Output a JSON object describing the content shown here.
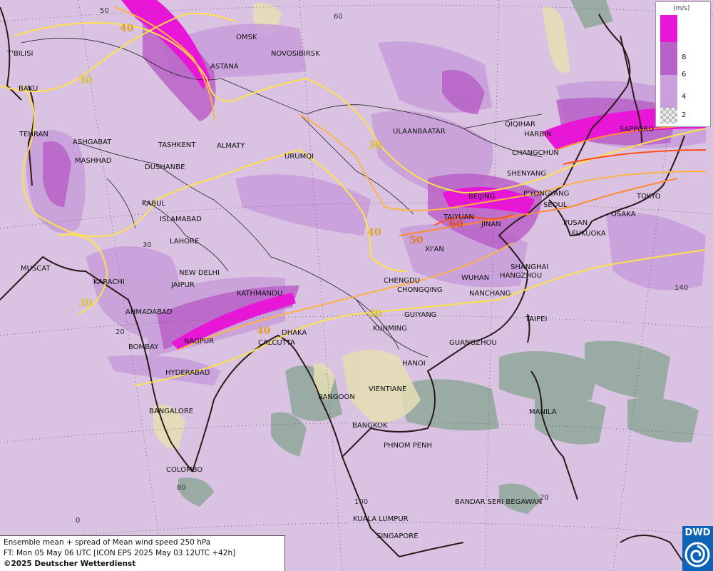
{
  "title_line": "Ensemble mean + spread of Mean wind speed 250 hPa",
  "forecast_line": "FT: Mon 05 May 06 UTC [ICON EPS 2025 May 03 12UTC +42h]",
  "copyright": "©2025 Deutscher Wetterdienst",
  "logo_text": "DWD",
  "legend": {
    "unit": "(m/s)",
    "ticks": [
      "8",
      "6",
      "4",
      "2"
    ],
    "colors": [
      "#e817d8",
      "#b862c7",
      "#c9a0db",
      "#d9c2e2"
    ]
  },
  "colors": {
    "background_spread": "#d9c2e2",
    "jet_core": "#e817d8",
    "contour_30": "#ffe24a",
    "contour_40": "#ffb347",
    "contour_50": "#ff8c33",
    "contour_60": "#ff4d1a",
    "coastline": "#2b1a1a"
  },
  "cities": [
    {
      "name": "T'BILISI"
    },
    {
      "name": "BAKU"
    },
    {
      "name": "TEHRAN"
    },
    {
      "name": "ASHGABAT"
    },
    {
      "name": "MASHHAD"
    },
    {
      "name": "MUSCAT"
    },
    {
      "name": "KARACHI"
    },
    {
      "name": "AHMADABAD"
    },
    {
      "name": "BOMBAY"
    },
    {
      "name": "HYDERABAD"
    },
    {
      "name": "BANGALORE"
    },
    {
      "name": "COLOMBO"
    },
    {
      "name": "OMSK"
    },
    {
      "name": "NOVOSIBIRSK"
    },
    {
      "name": "ASTANA"
    },
    {
      "name": "TASHKENT"
    },
    {
      "name": "ALMATY"
    },
    {
      "name": "DUSHANBE"
    },
    {
      "name": "KABUL"
    },
    {
      "name": "ISLAMABAD"
    },
    {
      "name": "LAHORE"
    },
    {
      "name": "NEW DELHI"
    },
    {
      "name": "JAIPUR"
    },
    {
      "name": "KATHMANDU"
    },
    {
      "name": "NAGPUR"
    },
    {
      "name": "CALCUTTA"
    },
    {
      "name": "DHAKA"
    },
    {
      "name": "URUMQI"
    },
    {
      "name": "ULAANBAATAR"
    },
    {
      "name": "CHENGDU"
    },
    {
      "name": "CHONGQING"
    },
    {
      "name": "KUNMING"
    },
    {
      "name": "GUIYANG"
    },
    {
      "name": "WUHAN"
    },
    {
      "name": "NANCHANG"
    },
    {
      "name": "XI'AN"
    },
    {
      "name": "TAIYUAN"
    },
    {
      "name": "JINAN"
    },
    {
      "name": "BEIJING"
    },
    {
      "name": "SHENYANG"
    },
    {
      "name": "CHANGCHUN"
    },
    {
      "name": "HARBIN"
    },
    {
      "name": "QIQIHAR"
    },
    {
      "name": "P'YONGYANG"
    },
    {
      "name": "SEOUL"
    },
    {
      "name": "PUSAN"
    },
    {
      "name": "FUKUOKA"
    },
    {
      "name": "OSAKA"
    },
    {
      "name": "TOKYO"
    },
    {
      "name": "SAPPORO"
    },
    {
      "name": "SHANGHAI"
    },
    {
      "name": "HANGZHOU"
    },
    {
      "name": "TAIPEI"
    },
    {
      "name": "GUANGZHOU"
    },
    {
      "name": "HANOI"
    },
    {
      "name": "VIENTIANE"
    },
    {
      "name": "RANGOON"
    },
    {
      "name": "BANGKOK"
    },
    {
      "name": "PHNOM PENH"
    },
    {
      "name": "MANILA"
    },
    {
      "name": "BANDAR SERI BEGAWAN"
    },
    {
      "name": "KUALA LUMPUR"
    },
    {
      "name": "SINGAPORE"
    }
  ],
  "contour_labels": [
    "40",
    "30",
    "30",
    "30",
    "40",
    "50",
    "60",
    "40",
    "30"
  ],
  "grid_labels": [
    "50",
    "60",
    "30",
    "20",
    "140",
    "80",
    "100",
    "0",
    "20"
  ]
}
